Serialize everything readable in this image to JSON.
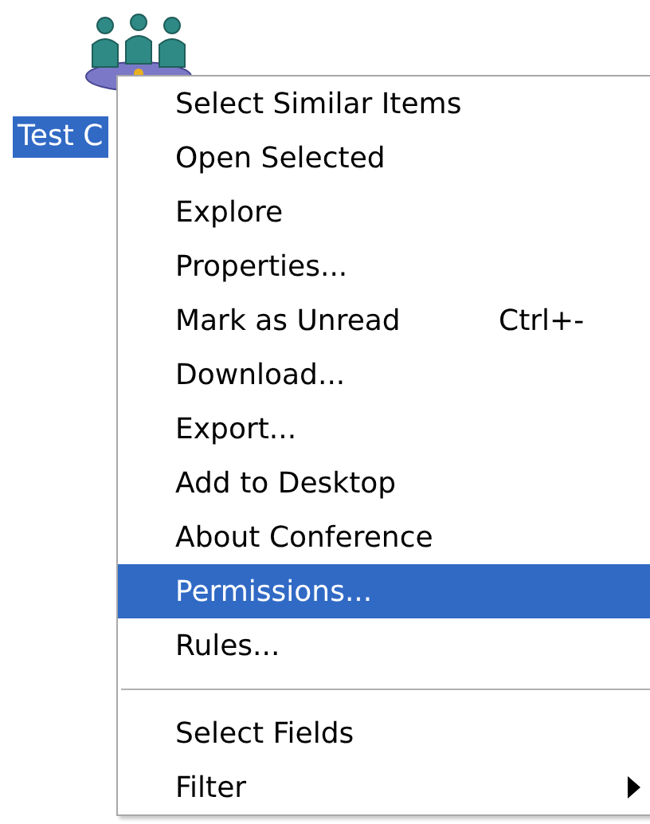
{
  "desktop_icon": {
    "label": "Test C",
    "selected": true
  },
  "context_menu": {
    "items": [
      {
        "kind": "item",
        "label": "Select Similar Items",
        "selected": false
      },
      {
        "kind": "item",
        "label": "Open Selected",
        "selected": false
      },
      {
        "kind": "item",
        "label": "Explore",
        "selected": false
      },
      {
        "kind": "item",
        "label": "Properties...",
        "selected": false
      },
      {
        "kind": "item",
        "label": "Mark as Unread",
        "shortcut": "Ctrl+-",
        "selected": false
      },
      {
        "kind": "item",
        "label": "Download...",
        "selected": false
      },
      {
        "kind": "item",
        "label": "Export...",
        "selected": false
      },
      {
        "kind": "item",
        "label": "Add to Desktop",
        "selected": false
      },
      {
        "kind": "item",
        "label": "About Conference",
        "selected": false
      },
      {
        "kind": "item",
        "label": "Permissions...",
        "selected": true
      },
      {
        "kind": "item",
        "label": "Rules...",
        "selected": false
      },
      {
        "kind": "separator"
      },
      {
        "kind": "item",
        "label": "Select Fields",
        "selected": false
      },
      {
        "kind": "submenu",
        "label": "Filter",
        "selected": false
      }
    ]
  }
}
